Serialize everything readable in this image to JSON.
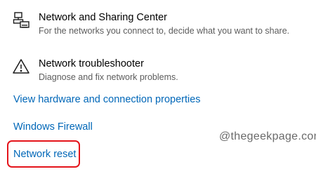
{
  "items": [
    {
      "title": "Network and Sharing Center",
      "description": "For the networks you connect to, decide what you want to share.",
      "icon": "network-sharing-icon"
    },
    {
      "title": "Network troubleshooter",
      "description": "Diagnose and fix network problems.",
      "icon": "warning-icon"
    }
  ],
  "links": [
    {
      "label": "View hardware and connection properties"
    },
    {
      "label": "Windows Firewall"
    },
    {
      "label": "Network reset"
    }
  ],
  "watermark": "@thegeekpage.com",
  "colors": {
    "link": "#0067b8",
    "highlight": "#e4141b",
    "description": "#5c5c5c"
  }
}
